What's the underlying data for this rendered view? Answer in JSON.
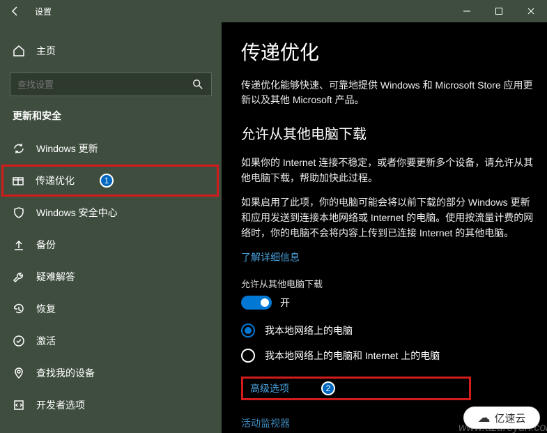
{
  "titlebar": {
    "title": "设置"
  },
  "sidebar": {
    "home": "主页",
    "search_placeholder": "查找设置",
    "section": "更新和安全",
    "items": [
      {
        "label": "Windows 更新"
      },
      {
        "label": "传递优化",
        "badge": "1"
      },
      {
        "label": "Windows 安全中心"
      },
      {
        "label": "备份"
      },
      {
        "label": "疑难解答"
      },
      {
        "label": "恢复"
      },
      {
        "label": "激活"
      },
      {
        "label": "查找我的设备"
      },
      {
        "label": "开发者选项"
      }
    ]
  },
  "content": {
    "heading": "传递优化",
    "intro": "传递优化能够快速、可靠地提供 Windows 和 Microsoft Store 应用更新以及其他 Microsoft 产品。",
    "subheading": "允许从其他电脑下载",
    "para1": "如果你的 Internet 连接不稳定，或者你要更新多个设备，请允许从其他电脑下载，帮助加快此过程。",
    "para2": "如果启用了此项，你的电脑可能会将以前下载的部分 Windows 更新和应用发送到连接本地网络或 Internet 的电脑。使用按流量计费的网络时，你的电脑不会将内容上传到已连接 Internet 的其他电脑。",
    "learn_more": "了解详细信息",
    "toggle_label": "允许从其他电脑下载",
    "toggle_state": "开",
    "radio1": "我本地网络上的电脑",
    "radio2": "我本地网络上的电脑和 Internet 上的电脑",
    "advanced": "高级选项",
    "advanced_badge": "2",
    "activity": "活动监视器"
  },
  "watermark": {
    "url": "www.azureyun.com",
    "brand": "亿速云"
  }
}
